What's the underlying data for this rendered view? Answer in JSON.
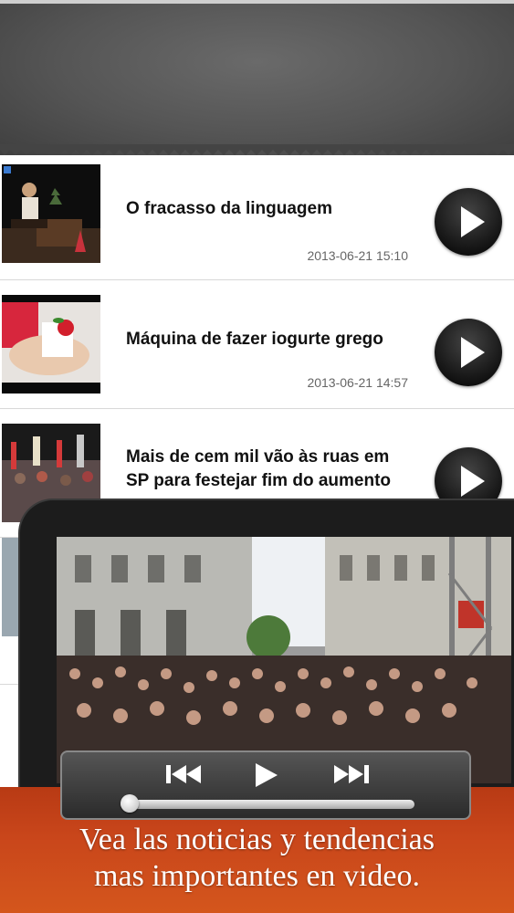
{
  "videos": [
    {
      "title": "O fracasso da linguagem",
      "timestamp": "2013-06-21 15:10",
      "play_icon": "play-icon"
    },
    {
      "title": "Máquina de fazer iogurte grego",
      "timestamp": "2013-06-21 14:57",
      "play_icon": "play-icon"
    },
    {
      "title_line1": "Mais de cem mil vão às ruas em",
      "title_line2": "SP para festejar fim do aumento",
      "play_icon": "play-icon"
    }
  ],
  "player": {
    "controls": [
      "previous-track-icon",
      "play-icon",
      "next-track-icon"
    ],
    "progress": 0.03
  },
  "banner": {
    "line1": "Vea las noticias y tendencias",
    "line2": "mas importantes en video."
  },
  "colors": {
    "banner": "#c9461b",
    "header": "#555555"
  }
}
